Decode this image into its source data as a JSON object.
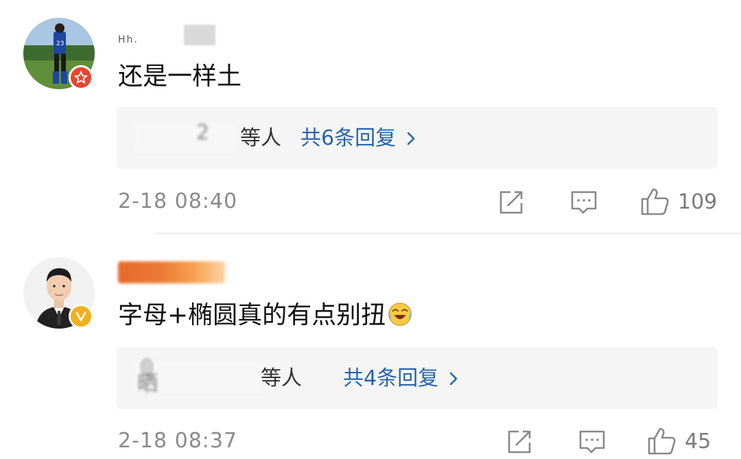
{
  "comments": [
    {
      "username_fragment": "Hh.",
      "text": "还是一样土",
      "replies": {
        "names_suffix": "等人",
        "count_label": "共6条回复",
        "smudge": "2"
      },
      "timestamp": "2-18 08:40",
      "actions": {
        "like_count": "109"
      },
      "badge": {
        "icon": "star-badge-icon",
        "color": "#e8462f"
      }
    },
    {
      "username_fragment": "",
      "text": "字母+椭圆真的有点别扭",
      "emoji": "laughing-crying-emoji",
      "replies": {
        "names_prefix": "晒",
        "names_suffix": "等人",
        "count_label": "共4条回复"
      },
      "timestamp": "2-18 08:37",
      "actions": {
        "like_count": "45"
      },
      "badge": {
        "icon": "verified-v-badge-icon",
        "color": "#f2b01e"
      }
    }
  ],
  "colors": {
    "link": "#2a63a8",
    "meta": "#8a8a8a",
    "reply_bg": "#f5f5f5"
  }
}
